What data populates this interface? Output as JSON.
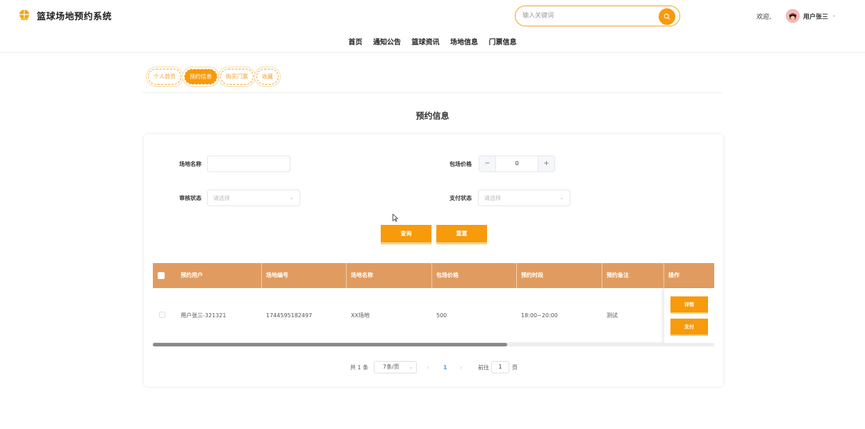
{
  "header": {
    "site_title": "篮球场地预约系统",
    "search_placeholder": "输入关键词",
    "welcome": "欢迎,",
    "username": "用户张三"
  },
  "nav": [
    "首页",
    "通知公告",
    "篮球资讯",
    "场地信息",
    "门票信息"
  ],
  "subtabs": [
    {
      "label": "个人首页",
      "active": false
    },
    {
      "label": "预约信息",
      "active": true
    },
    {
      "label": "购买门票",
      "active": false
    },
    {
      "label": "收藏",
      "active": false
    }
  ],
  "page": {
    "title": "预约信息"
  },
  "filters": {
    "venue_name_label": "场地名称",
    "venue_name_value": "",
    "price_label": "包场价格",
    "price_value": "0",
    "review_status_label": "审核状态",
    "review_status_placeholder": "请选择",
    "pay_status_label": "支付状态",
    "pay_status_placeholder": "请选择",
    "query_label": "查询",
    "reset_label": "重置"
  },
  "table": {
    "columns": [
      "预约用户",
      "场地编号",
      "场地名称",
      "包场价格",
      "预约时段",
      "预约备注",
      "操作"
    ],
    "rows": [
      {
        "user": "用户张三-321321",
        "venue_no": "1744595182497",
        "venue_name": "XX场地",
        "price": "500",
        "time_slot": "18:00~20:00",
        "remark": "测试",
        "actions": [
          "详情",
          "支付"
        ]
      }
    ]
  },
  "pagination": {
    "total": "共 1 条",
    "page_size": "7条/页",
    "current_page": "1",
    "goto_label": "前往",
    "goto_value": "1",
    "page_suffix": "页"
  },
  "colors": {
    "accent": "#f79a0c",
    "table_header": "#e09c60"
  }
}
